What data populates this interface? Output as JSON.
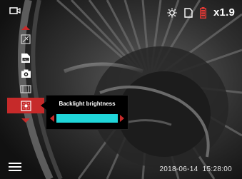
{
  "status": {
    "zoom": "x1.9",
    "icons": [
      "camera-mode-icon",
      "settings-gear-icon",
      "sd-card-icon",
      "battery-icon"
    ],
    "battery_color": "#e53935"
  },
  "menu": {
    "items": [
      {
        "name": "shutter-correction-icon",
        "active": false
      },
      {
        "name": "pic-format-icon",
        "active": false
      },
      {
        "name": "screenshot-icon",
        "active": false
      },
      {
        "name": "video-clip-icon",
        "active": false
      },
      {
        "name": "brightness-icon",
        "active": true
      }
    ]
  },
  "popup": {
    "title": "Backlight brightness",
    "level": 1.0,
    "fill_color": "#20d6d9",
    "arrow_color": "#c62a2a"
  },
  "footer": {
    "datetime": "2018-06-14  15:28:00",
    "menu_icon": "hamburger-menu-icon"
  },
  "colors": {
    "accent": "#c62a2a",
    "text": "#ffffff"
  }
}
